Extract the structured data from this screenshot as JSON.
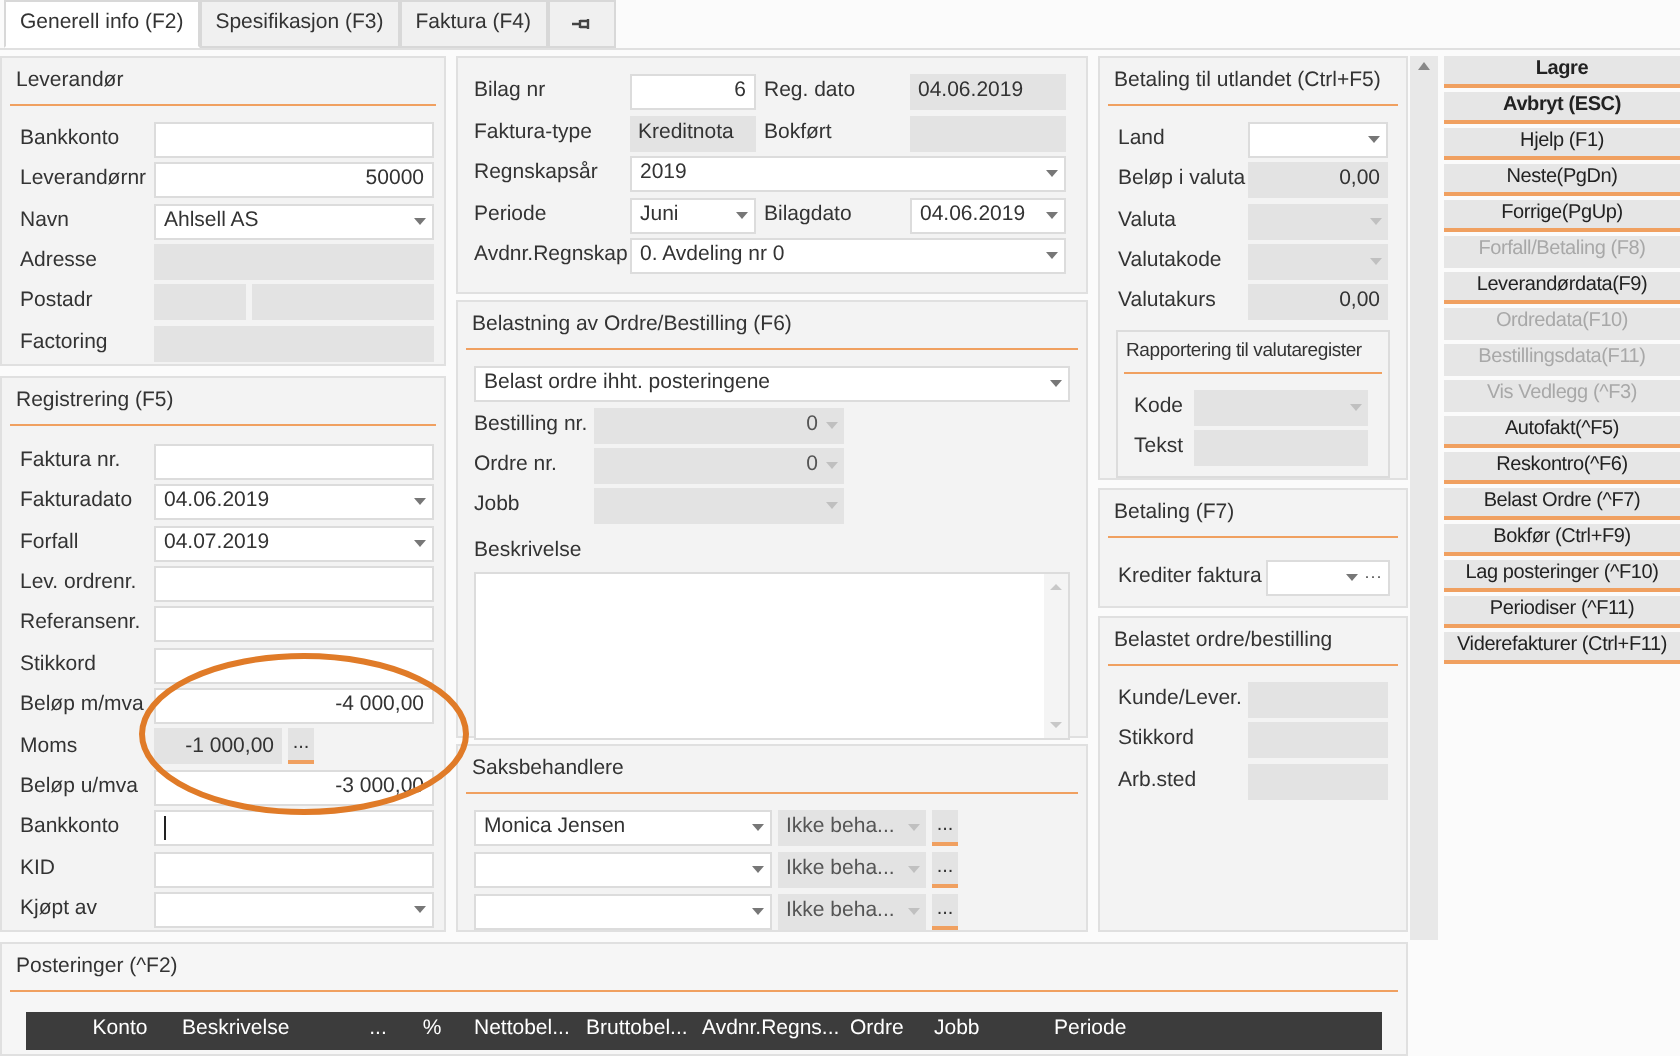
{
  "tabs": [
    {
      "label": "Generell info (F2)",
      "selected": true
    },
    {
      "label": "Spesifikasjon (F3)",
      "selected": false
    },
    {
      "label": "Faktura (F4)",
      "selected": false
    }
  ],
  "leverandor": {
    "title": "Leverandør",
    "fields": [
      {
        "label": "Bankkonto",
        "kind": "input"
      },
      {
        "label": "Leverandørnr",
        "kind": "number",
        "value": "50000"
      },
      {
        "label": "Navn",
        "kind": "select",
        "value": "Ahlsell AS"
      },
      {
        "label": "Adresse",
        "kind": "readonly"
      },
      {
        "label": "Postadr",
        "kind": "split"
      },
      {
        "label": "Factoring",
        "kind": "readonly"
      }
    ]
  },
  "registrering": {
    "title": "Registrering (F5)",
    "fields": [
      {
        "label": "Faktura nr.",
        "kind": "input"
      },
      {
        "label": "Fakturadato",
        "kind": "select",
        "value": "04.06.2019"
      },
      {
        "label": "Forfall",
        "kind": "select",
        "value": "04.07.2019"
      },
      {
        "label": "Lev. ordrenr.",
        "kind": "input"
      },
      {
        "label": "Referansenr.",
        "kind": "input"
      },
      {
        "label": "Stikkord",
        "kind": "input"
      },
      {
        "label": "Beløp m/mva",
        "kind": "number",
        "value": "-4 000,00"
      },
      {
        "label": "Moms",
        "kind": "readonly_number",
        "value": "-1 000,00",
        "button": "..."
      },
      {
        "label": "Beløp u/mva",
        "kind": "number",
        "value": "-3 000,00"
      },
      {
        "label": "Bankkonto",
        "kind": "input",
        "focused": true
      },
      {
        "label": "KID",
        "kind": "input"
      },
      {
        "label": "Kjøpt av",
        "kind": "select"
      }
    ]
  },
  "bilag": {
    "rows": [
      [
        {
          "label": "Bilag nr",
          "kind": "number",
          "value": "6"
        },
        {
          "label": "Reg. dato",
          "kind": "readonly",
          "value": "04.06.2019"
        }
      ],
      [
        {
          "label": "Faktura-type",
          "kind": "readonly",
          "value": "Kreditnota"
        },
        {
          "label": "Bokført",
          "kind": "readonly"
        }
      ],
      [
        {
          "label": "Regnskapsår",
          "kind": "select",
          "value": "2019"
        }
      ],
      [
        {
          "label": "Periode",
          "kind": "select",
          "value": "Juni"
        },
        {
          "label": "Bilagdato",
          "kind": "select",
          "value": "04.06.2019"
        }
      ],
      [
        {
          "label": "Avdnr.Regnskap",
          "kind": "select",
          "value": "0.  Avdeling nr 0"
        }
      ]
    ]
  },
  "belastning": {
    "title": "Belastning av Ordre/Bestilling (F6)",
    "mode": {
      "kind": "select",
      "value": "Belast ordre ihht. posteringene"
    },
    "fields": [
      {
        "label": "Bestilling nr.",
        "kind": "select_disabled_number",
        "value": "0"
      },
      {
        "label": "Ordre nr.",
        "kind": "select_disabled_number",
        "value": "0"
      },
      {
        "label": "Jobb",
        "kind": "select_disabled"
      }
    ],
    "description_label": "Beskrivelse"
  },
  "saksbehandlere": {
    "title": "Saksbehandlere",
    "rows": [
      {
        "person": "Monica Jensen",
        "status": "Ikke beha...",
        "button": "..."
      },
      {
        "status": "Ikke beha...",
        "button": "..."
      },
      {
        "status": "Ikke beha...",
        "button": "..."
      }
    ]
  },
  "utland": {
    "title": "Betaling til utlandet (Ctrl+F5)",
    "fields": [
      {
        "label": "Land",
        "kind": "select"
      },
      {
        "label": "Beløp i valuta",
        "kind": "readonly_number",
        "value": "0,00"
      },
      {
        "label": "Valuta",
        "kind": "select_disabled"
      },
      {
        "label": "Valutakode",
        "kind": "select_disabled"
      },
      {
        "label": "Valutakurs",
        "kind": "readonly_number",
        "value": "0,00"
      }
    ],
    "reporting": {
      "title": "Rapportering til valutaregister",
      "fields": [
        {
          "label": "Kode",
          "kind": "select_disabled"
        },
        {
          "label": "Tekst",
          "kind": "readonly"
        }
      ]
    }
  },
  "betaling": {
    "title": "Betaling (F7)",
    "fields": [
      {
        "label": "Krediter faktura",
        "kind": "select",
        "button": "···"
      }
    ]
  },
  "belastet": {
    "title": "Belastet ordre/bestilling",
    "fields": [
      {
        "label": "Kunde/Lever.",
        "kind": "readonly"
      },
      {
        "label": "Stikkord",
        "kind": "readonly"
      },
      {
        "label": "Arb.sted",
        "kind": "readonly"
      }
    ]
  },
  "buttons": [
    {
      "label": "Lagre",
      "primary": true,
      "disabled": false
    },
    {
      "label": "Avbryt (ESC)",
      "primary": true,
      "disabled": false
    },
    {
      "label": "Hjelp (F1)",
      "primary": false,
      "disabled": false
    },
    {
      "label": "Neste(PgDn)",
      "primary": false,
      "disabled": false
    },
    {
      "label": "Forrige(PgUp)",
      "primary": false,
      "disabled": false
    },
    {
      "label": "Forfall/Betaling (F8)",
      "primary": false,
      "disabled": true
    },
    {
      "label": "Leverandørdata(F9)",
      "primary": false,
      "disabled": false
    },
    {
      "label": "Ordredata(F10)",
      "primary": false,
      "disabled": true
    },
    {
      "label": "Bestillingsdata(F11)",
      "primary": false,
      "disabled": true
    },
    {
      "label": "Vis Vedlegg (^F3)",
      "primary": false,
      "disabled": true
    },
    {
      "label": "Autofakt(^F5)",
      "primary": false,
      "disabled": false
    },
    {
      "label": "Reskontro(^F6)",
      "primary": false,
      "disabled": false
    },
    {
      "label": "Belast Ordre (^F7)",
      "primary": false,
      "disabled": false
    },
    {
      "label": "Bokfør (Ctrl+F9)",
      "primary": false,
      "disabled": false
    },
    {
      "label": "Lag posteringer (^F10)",
      "primary": false,
      "disabled": false
    },
    {
      "label": "Periodiser (^F11)",
      "primary": false,
      "disabled": false
    },
    {
      "label": "Viderefakturer (Ctrl+F11)",
      "primary": false,
      "disabled": false
    }
  ],
  "posteringer": {
    "title": "Posteringer (^F2)",
    "columns": [
      "Konto",
      "Beskrivelse",
      "...",
      "%",
      "Nettobel...",
      "Bruttobel...",
      "Avdnr.Regns...",
      "Ordre",
      "Jobb",
      "Periode"
    ]
  }
}
